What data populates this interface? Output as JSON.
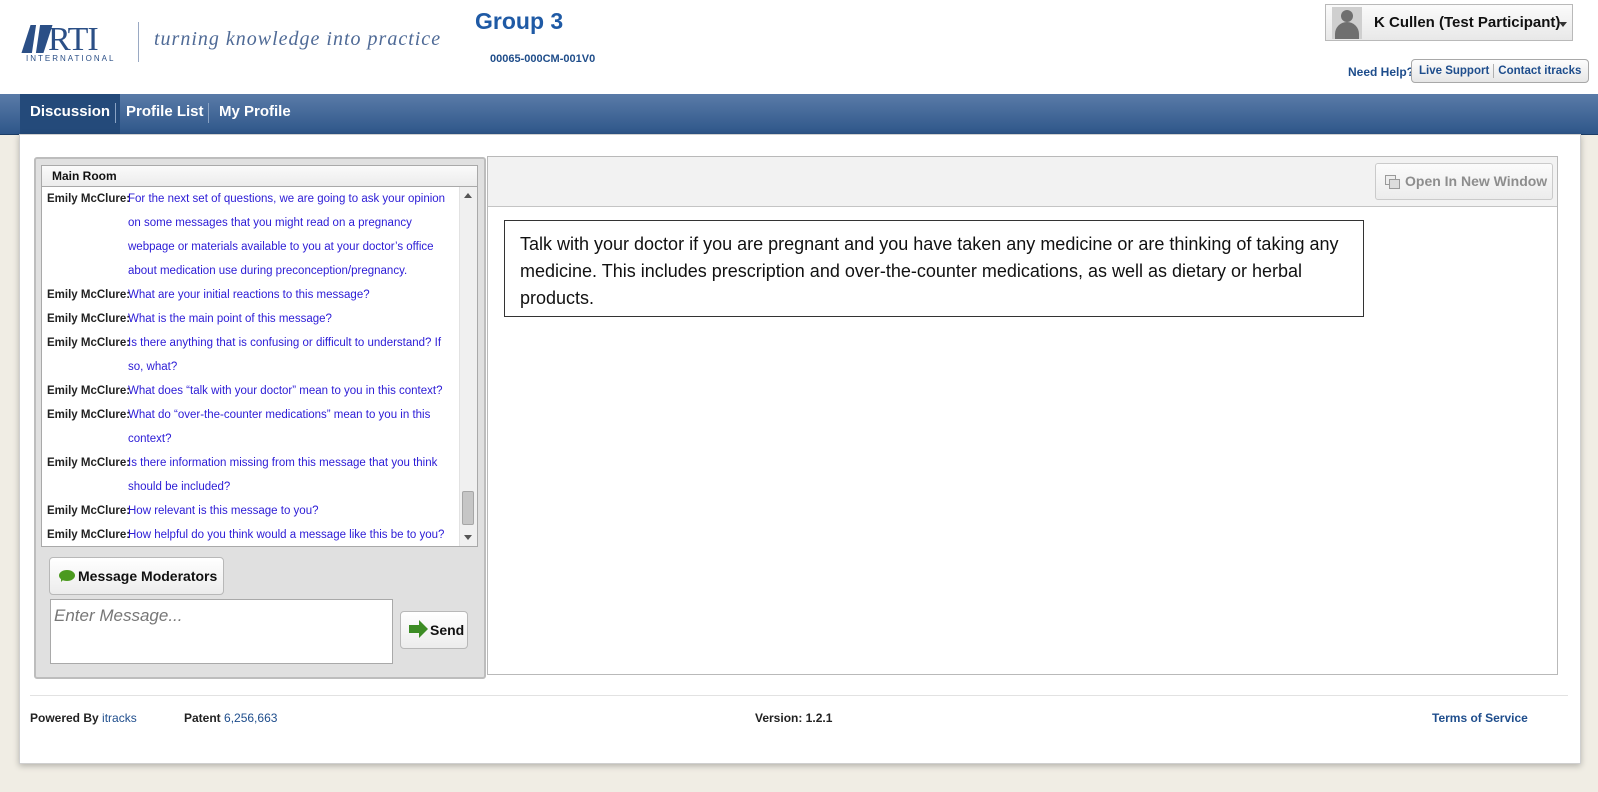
{
  "header": {
    "logo_text": "RTI",
    "logo_subtext": "INTERNATIONAL",
    "tagline": "turning knowledge into practice",
    "group_title": "Group 3",
    "project_code": "00065-000CM-001V0",
    "user_name": "K Cullen (Test Participant)",
    "need_help": "Need Help?",
    "live_support": "Live Support",
    "contact": "Contact itracks"
  },
  "nav": {
    "items": [
      {
        "label": "Discussion",
        "active": true
      },
      {
        "label": "Profile List",
        "active": false
      },
      {
        "label": "My Profile",
        "active": false
      }
    ]
  },
  "chat": {
    "room_title": "Main Room",
    "messages": [
      {
        "author": "Emily McClure:",
        "text": "For the next set of questions, we are going to ask your opinion on some messages that you might read on a pregnancy webpage or materials available to you at your doctor’s office about medication use during preconception/pregnancy."
      },
      {
        "author": "Emily McClure:",
        "text": "What are your initial reactions to this message?"
      },
      {
        "author": "Emily McClure:",
        "text": "What is the main point of this message?"
      },
      {
        "author": "Emily McClure:",
        "text": "Is there anything that is confusing or difficult to understand? If so, what?"
      },
      {
        "author": "Emily McClure:",
        "text": "What does “talk with your doctor” mean to you in this context?"
      },
      {
        "author": "Emily McClure:",
        "text": "What do “over-the-counter medications” mean to you in this context?"
      },
      {
        "author": "Emily McClure:",
        "text": "Is there information missing from this message that you think should be included?"
      },
      {
        "author": "Emily McClure:",
        "text": "How relevant is this message to you?"
      },
      {
        "author": "Emily McClure:",
        "text": "How helpful do you think would a message like this be to you?"
      }
    ],
    "moderator_button": "Message Moderators",
    "input_placeholder": "Enter Message...",
    "send_button": "Send"
  },
  "viewer": {
    "open_window_button": "Open In New Window",
    "stimulus_text": "Talk with your doctor if you are pregnant and you have taken any medicine or are thinking of taking any medicine. This includes prescription and over-the-counter medications, as well as dietary or herbal products."
  },
  "footer": {
    "powered_by_label": "Powered By",
    "powered_by_link": "itracks",
    "patent_label": "Patent",
    "patent_number": "6,256,663",
    "version": "Version: 1.2.1",
    "terms": "Terms of Service"
  },
  "icons": {
    "user_avatar": "user-silhouette-icon",
    "menu_caret": "chevron-down-icon",
    "moderator": "speech-bubble-icon",
    "send": "arrow-right-icon",
    "open_window": "new-window-icon",
    "scroll_up": "scroll-up-icon",
    "scroll_down": "scroll-down-icon"
  },
  "colors": {
    "nav_bar": "#2e5689",
    "link_blue": "#1e4d8c",
    "message_text": "#2b1bd6",
    "brand_blue": "#2b4f86"
  }
}
